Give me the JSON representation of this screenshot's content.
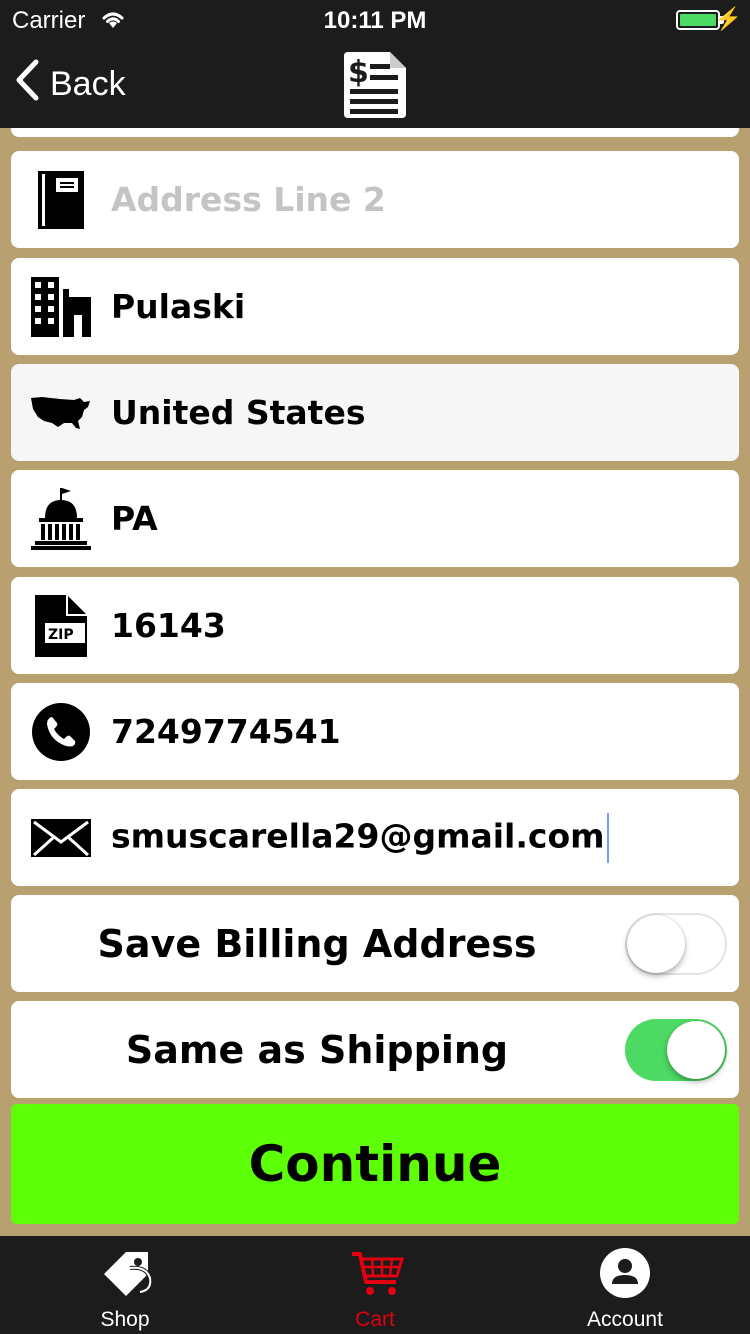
{
  "status_bar": {
    "carrier": "Carrier",
    "time": "10:11 PM",
    "battery_level": 1.0,
    "icons": [
      "wifi-icon",
      "battery-icon",
      "charging-icon"
    ]
  },
  "nav": {
    "back_label": "Back",
    "logo_icon": "invoice-dollar-icon"
  },
  "form": {
    "fields": [
      {
        "name": "address-line-2",
        "icon": "address-book-icon",
        "value": "",
        "placeholder": "Address Line 2"
      },
      {
        "name": "city",
        "icon": "buildings-icon",
        "value": "Pulaski",
        "placeholder": ""
      },
      {
        "name": "country",
        "icon": "usa-map-icon",
        "value": "United States",
        "placeholder": "",
        "disabled": true
      },
      {
        "name": "state",
        "icon": "capitol-icon",
        "value": "PA",
        "placeholder": ""
      },
      {
        "name": "zip",
        "icon": "zip-file-icon",
        "value": "16143",
        "placeholder": ""
      },
      {
        "name": "phone",
        "icon": "phone-icon",
        "value": "7249774541",
        "placeholder": ""
      },
      {
        "name": "email",
        "icon": "envelope-icon",
        "value": "smuscarella29@gmail.com",
        "placeholder": "",
        "focused": true
      }
    ],
    "toggles": [
      {
        "label": "Save Billing Address",
        "on": false
      },
      {
        "label": "Same as Shipping",
        "on": true
      }
    ],
    "continue_label": "Continue"
  },
  "tab_bar": {
    "tabs": [
      {
        "label": "Shop",
        "icon": "price-tag-icon",
        "active": false
      },
      {
        "label": "Cart",
        "icon": "cart-icon",
        "active": true
      },
      {
        "label": "Account",
        "icon": "user-icon",
        "active": false
      }
    ]
  },
  "colors": {
    "background": "#b8a070",
    "bars": "#1c1c1c",
    "continue": "#5cff05",
    "toggle_on": "#4cd964",
    "active_tab": "#e0000f",
    "placeholder": "#c4c4c4"
  }
}
